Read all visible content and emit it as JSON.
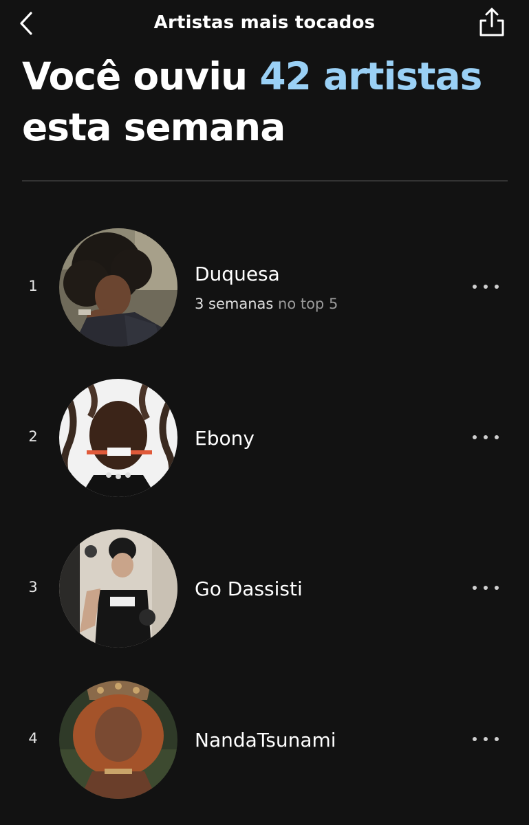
{
  "header": {
    "title": "Artistas mais tocados",
    "back_icon": "chevron-left-icon",
    "share_icon": "share-icon"
  },
  "headline": {
    "prefix": "Você ouviu ",
    "highlight": "42 artistas",
    "suffix": "esta semana",
    "highlight_color": "#9ad0f5"
  },
  "artists": [
    {
      "rank": "1",
      "name": "Duquesa",
      "subtitle_strong": "3 semanas",
      "subtitle_muted": " no top 5"
    },
    {
      "rank": "2",
      "name": "Ebony"
    },
    {
      "rank": "3",
      "name": "Go Dassisti"
    },
    {
      "rank": "4",
      "name": "NandaTsunami"
    }
  ],
  "colors": {
    "background": "#121212",
    "accent": "#9ad0f5",
    "muted_text": "#9a9a9a"
  }
}
